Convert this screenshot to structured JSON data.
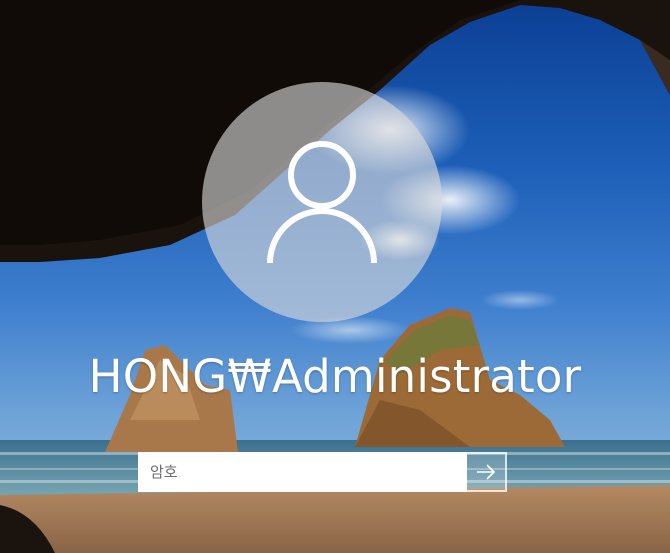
{
  "login": {
    "username": "HONG₩Administrator",
    "password_placeholder": "암호",
    "password_value": ""
  },
  "icons": {
    "avatar": "user-silhouette-icon",
    "submit": "arrow-right-icon"
  },
  "colors": {
    "text": "#ffffff",
    "avatar_bg": "rgba(220,220,220,0.62)",
    "input_bg": "#ffffff"
  }
}
